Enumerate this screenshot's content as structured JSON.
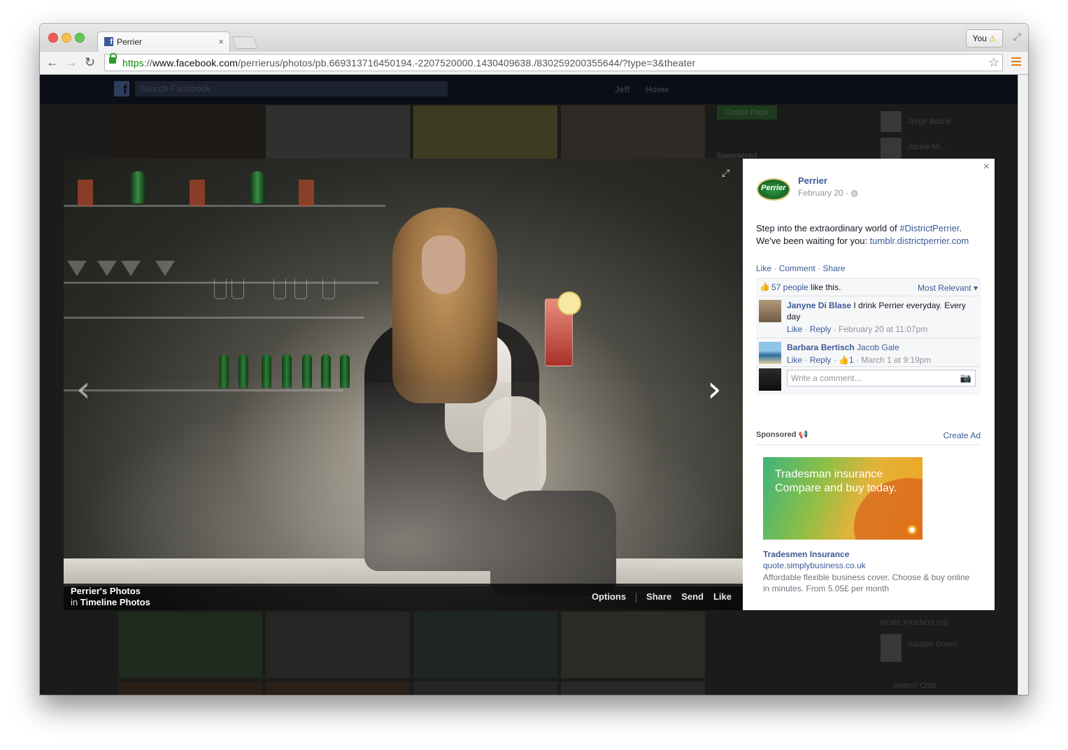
{
  "browser": {
    "tab_title": "Perrier",
    "tab_close": "×",
    "profile_label": "You",
    "url_scheme": "https",
    "url_sep": "://",
    "url_domain": "www.facebook.com",
    "url_path": "/perrierus/photos/pb.669313716450194.-2207520000.1430409638./830259200355644/?type=3&theater"
  },
  "fb_header": {
    "search_placeholder": "Search Facebook",
    "user_name": "Jeff",
    "home_label": "Home",
    "create_page": "Create Page",
    "sponsored_bg": "Sponsored"
  },
  "chat_sidebar": {
    "friends": [
      "Jorge Bache",
      "Jackie Mi..."
    ],
    "more_friends": "MORE FRIENDS (23)",
    "friend_bottom": "Alastair Green",
    "search_chat": "Search Chat"
  },
  "photo": {
    "album_title": "Perrier's Photos",
    "in_label": "in",
    "album_sub": "Timeline Photos",
    "actions": [
      "Options",
      "Share",
      "Send",
      "Like"
    ]
  },
  "post": {
    "page_name": "Perrier",
    "date": "February 20 ·",
    "logo_text": "Perrier",
    "text_1": "Step into the extraordinary world of ",
    "hashtag": "#DistrictPerrier",
    "text_2": ". We've been waiting for you: ",
    "link": "tumblr.districtperrier.com",
    "action_like": "Like",
    "action_comment": "Comment",
    "action_share": "Share",
    "likes_count": "57 people",
    "likes_suffix": " like this.",
    "sort_label": "Most Relevant ▾"
  },
  "comments": [
    {
      "name": "Janyne Di Blase",
      "text": " I drink Perrier everyday. Every day",
      "like": "Like",
      "reply": "Reply",
      "time": "February 20 at 11:07pm",
      "like_count": ""
    },
    {
      "name": "Barbara Bertisch",
      "text": " Jacob Gale",
      "like": "Like",
      "reply": "Reply",
      "time": "March 1 at 9:19pm",
      "like_count": "1"
    }
  ],
  "write_comment_placeholder": "Write a comment...",
  "sponsored": {
    "label": "Sponsored",
    "create_ad": "Create Ad",
    "ad_line1": "Tradesman insurance",
    "ad_line2": "Compare and buy today.",
    "ad_title": "Tradesmen Insurance",
    "ad_domain": "quote.simplybusiness.co.uk",
    "ad_desc": "Affordable flexible business cover. Choose & buy online in minutes. From 5.05£ per month"
  },
  "colors": {
    "fb_blue": "#3b5998",
    "secure_green": "#0a8a0a",
    "menu_orange": "#e87c00"
  }
}
